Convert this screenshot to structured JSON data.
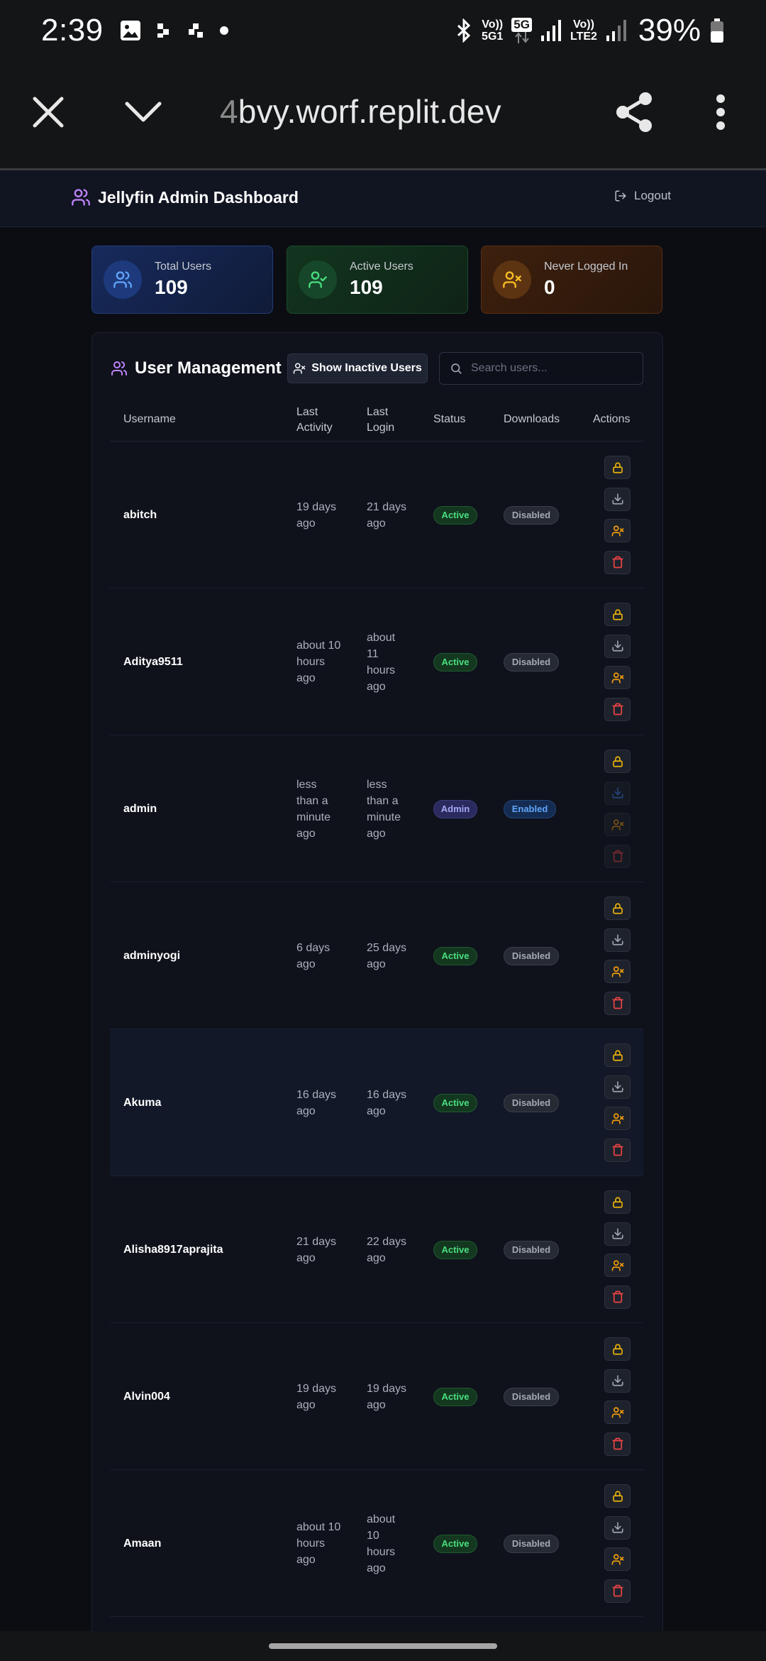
{
  "statusbar": {
    "time": "2:39",
    "battery": "39%",
    "volte1": "Vo))",
    "volte1_sub": "5G1",
    "net": "5G",
    "volte2": "Vo))",
    "volte2_sub": "LTE2"
  },
  "browser": {
    "url_dim": "4",
    "url_main": "bvy.worf.replit.dev"
  },
  "header": {
    "title": "Jellyfin Admin Dashboard",
    "logout": "Logout"
  },
  "stats": [
    {
      "label": "Total Users",
      "value": "109",
      "accent": "#60a5fa"
    },
    {
      "label": "Active Users",
      "value": "109",
      "accent": "#4ade80"
    },
    {
      "label": "Never Logged In",
      "value": "0",
      "accent": "#fbbf24"
    }
  ],
  "panel": {
    "title": "User Management",
    "show_inactive": "Show Inactive Users",
    "search_placeholder": "Search users..."
  },
  "columns": {
    "username": "Username",
    "last_activity_1": "Last",
    "last_activity_2": "Activity",
    "last_login_1": "Last",
    "last_login_2": "Login",
    "status": "Status",
    "downloads": "Downloads",
    "actions": "Actions"
  },
  "users": [
    {
      "username": "abitch",
      "last_activity": [
        "19 days",
        "ago"
      ],
      "last_login": [
        "21 days",
        "ago"
      ],
      "status": "Active",
      "downloads": "Disabled"
    },
    {
      "username": "Aditya9511",
      "last_activity": [
        "about 10",
        "hours",
        "ago"
      ],
      "last_login": [
        "about",
        "11",
        "hours",
        "ago"
      ],
      "status": "Active",
      "downloads": "Disabled"
    },
    {
      "username": "admin",
      "last_activity": [
        "less",
        "than a",
        "minute",
        "ago"
      ],
      "last_login": [
        "less",
        "than a",
        "minute",
        "ago"
      ],
      "status": "Admin",
      "downloads": "Enabled"
    },
    {
      "username": "adminyogi",
      "last_activity": [
        "6 days",
        "ago"
      ],
      "last_login": [
        "25 days",
        "ago"
      ],
      "status": "Active",
      "downloads": "Disabled"
    },
    {
      "username": "Akuma",
      "last_activity": [
        "16 days",
        "ago"
      ],
      "last_login": [
        "16 days",
        "ago"
      ],
      "status": "Active",
      "downloads": "Disabled"
    },
    {
      "username": "Alisha8917aprajita",
      "last_activity": [
        "21 days",
        "ago"
      ],
      "last_login": [
        "22 days",
        "ago"
      ],
      "status": "Active",
      "downloads": "Disabled"
    },
    {
      "username": "Alvin004",
      "last_activity": [
        "19 days",
        "ago"
      ],
      "last_login": [
        "19 days",
        "ago"
      ],
      "status": "Active",
      "downloads": "Disabled"
    },
    {
      "username": "Amaan",
      "last_activity": [
        "about 10",
        "hours",
        "ago"
      ],
      "last_login": [
        "about",
        "10",
        "hours",
        "ago"
      ],
      "status": "Active",
      "downloads": "Disabled"
    }
  ],
  "colors": {
    "lock": "#eab308",
    "download": "#9ca3af",
    "user_x": "#f59e0b",
    "trash": "#ef4444"
  }
}
